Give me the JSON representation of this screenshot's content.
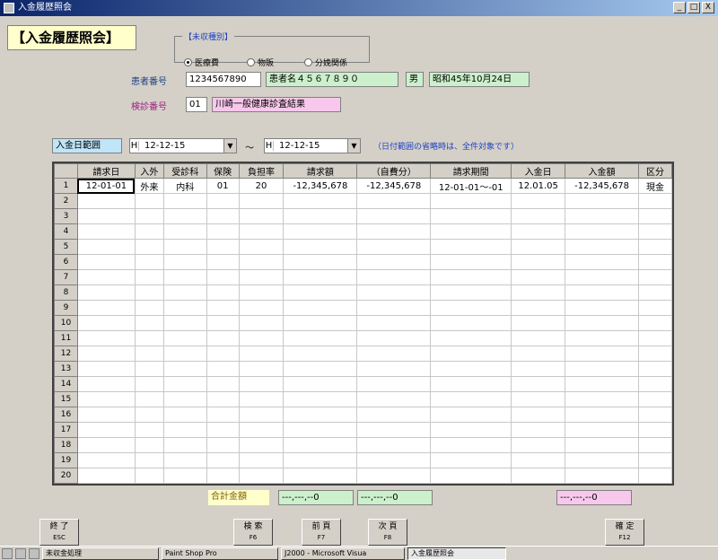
{
  "window": {
    "title": "入金履歴照会",
    "buttons": [
      "_",
      "□",
      "X"
    ]
  },
  "screen_title": "【入金履歴照会】",
  "category": {
    "legend": "【未収種別】",
    "options": [
      {
        "label": "医療費",
        "selected": true
      },
      {
        "label": "物販",
        "selected": false
      },
      {
        "label": "分娩関係",
        "selected": false
      }
    ]
  },
  "patient": {
    "label": "患者番号",
    "number": "1234567890",
    "name": "患者名４５６７８９０",
    "sex": "男",
    "birthdate": "昭和45年10月24日"
  },
  "insurance": {
    "label": "検診番号",
    "code": "01",
    "name": "川崎一般健康診査結果"
  },
  "date_range": {
    "label": "入金日範囲",
    "from_prefix": "H",
    "from": "12-12-15",
    "tilde": "～",
    "to_prefix": "H",
    "to": "12-12-15",
    "note": "（日付範囲の省略時は、全件対象です）"
  },
  "table": {
    "columns": [
      "請求日",
      "入外",
      "受診科",
      "保険",
      "負担率",
      "請求額",
      "（自費分）",
      "請求期間",
      "入金日",
      "入金額",
      "区分"
    ],
    "rows": [
      [
        "12-01-01",
        "外来",
        "内科",
        "01",
        "20",
        "-12,345,678",
        "-12,345,678",
        "12-01-01～-01",
        "12.01.05",
        "-12,345,678",
        "現金"
      ]
    ],
    "row_count": 20
  },
  "totals": {
    "label": "合計金額",
    "value1": "---,---,--0",
    "value2": "---,---,--0",
    "value3": "---,---,--0"
  },
  "fkeys": [
    {
      "label": "終 了",
      "key": "ESC"
    },
    {
      "label": "検 索",
      "key": "F6"
    },
    {
      "label": "前 頁",
      "key": "F7"
    },
    {
      "label": "次 頁",
      "key": "F8"
    },
    {
      "label": "確 定",
      "key": "F12"
    }
  ],
  "taskbar": [
    "未収金処理",
    "Paint Shop Pro",
    "J2000 - Microsoft Visua",
    "入金履歴照会"
  ]
}
